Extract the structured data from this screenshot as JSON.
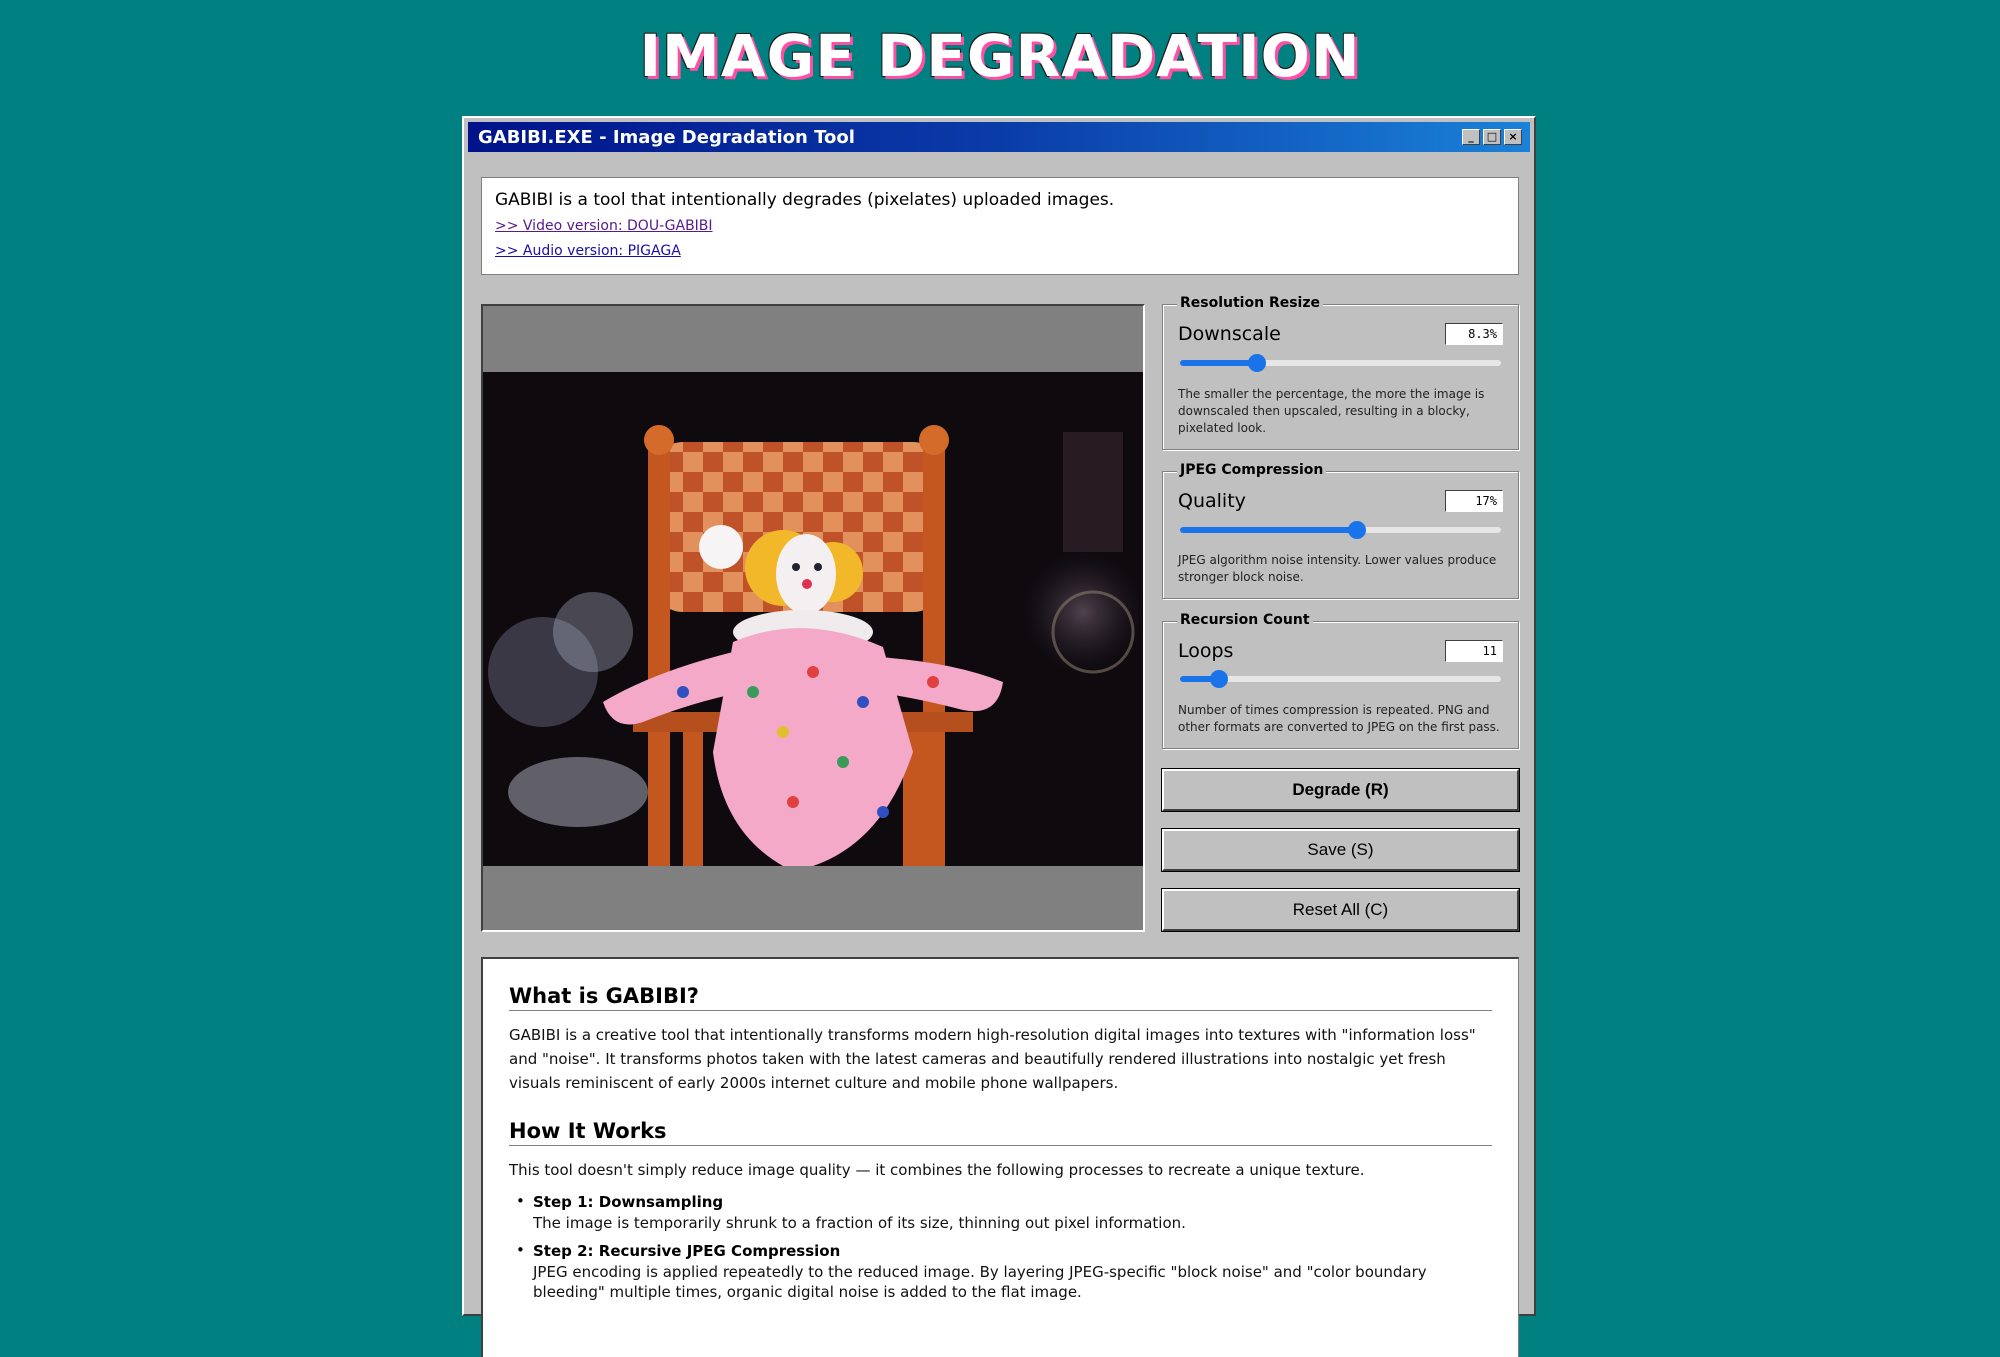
{
  "page": {
    "title": "IMAGE DEGRADATION"
  },
  "window": {
    "title": "GABIBI.EXE - Image Degradation Tool",
    "buttons": {
      "minimize": "_",
      "maximize": "□",
      "close": "×"
    }
  },
  "intro": {
    "text": "GABIBI is a tool that intentionally degrades (pixelates) uploaded images.",
    "video_link": ">> Video version: DOU-GABIBI",
    "audio_link": ">> Audio version: PIGAGA"
  },
  "controls": {
    "resolution": {
      "legend": "Resolution Resize",
      "label": "Downscale",
      "value": "8.3%",
      "fraction": 0.24,
      "description": "The smaller the percentage, the more the image is downscaled then upscaled, resulting in a blocky, pixelated look."
    },
    "jpeg": {
      "legend": "JPEG Compression",
      "label": "Quality",
      "value": "17%",
      "fraction": 0.55,
      "description": "JPEG algorithm noise intensity. Lower values produce stronger block noise."
    },
    "recursion": {
      "legend": "Recursion Count",
      "label": "Loops",
      "value": "11",
      "fraction": 0.12,
      "description": "Number of times compression is repeated. PNG and other formats are converted to JPEG on the first pass."
    }
  },
  "buttons": {
    "degrade": "Degrade (R)",
    "save": "Save (S)",
    "reset": "Reset All (C)"
  },
  "info": {
    "what_title": "What is GABIBI?",
    "what_body": "GABIBI is a creative tool that intentionally transforms modern high-resolution digital images into textures with \"information loss\" and \"noise\". It transforms photos taken with the latest cameras and beautifully rendered illustrations into nostalgic yet fresh visuals reminiscent of early 2000s internet culture and mobile phone wallpapers.",
    "how_title": "How It Works",
    "how_intro": "This tool doesn't simply reduce image quality — it combines the following processes to recreate a unique texture.",
    "steps": [
      {
        "title": "Step 1: Downsampling",
        "desc": "The image is temporarily shrunk to a fraction of its size, thinning out pixel information."
      },
      {
        "title": "Step 2: Recursive JPEG Compression",
        "desc": "JPEG encoding is applied repeatedly to the reduced image. By layering JPEG-specific \"block noise\" and \"color boundary bleeding\" multiple times, organic digital noise is added to the flat image."
      }
    ]
  },
  "colors": {
    "desktop": "#008080",
    "window": "#c0c0c0",
    "titlebar_start": "#00128a",
    "titlebar_end": "#1a82d8",
    "slider_accent": "#1a73e8",
    "link": "#1a0dab"
  }
}
